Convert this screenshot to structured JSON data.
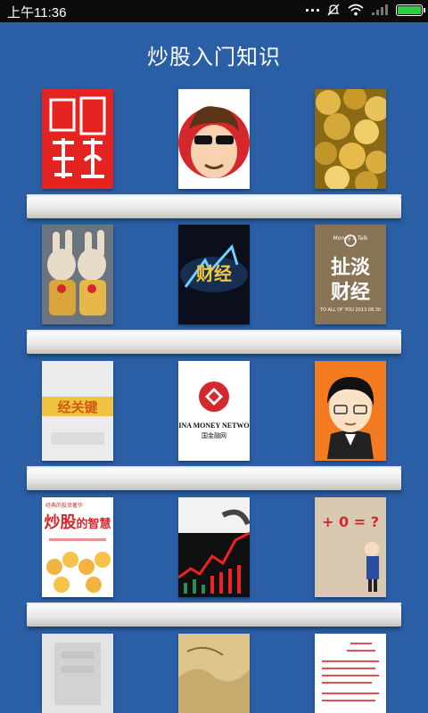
{
  "status_bar": {
    "time": "上午11:36"
  },
  "page_title": "炒股入门知识",
  "colors": {
    "background": "#2a5fa6",
    "status_bar": "#0c0c0c",
    "battery": "#2ecc40"
  },
  "books": [
    {
      "cover_text": ""
    },
    {
      "cover_text": ""
    },
    {
      "cover_text": ""
    },
    {
      "cover_text": ""
    },
    {
      "cover_text": ""
    },
    {
      "cover_line1": "扯淡",
      "cover_line2": "财经",
      "cover_top": "Money $ Talk",
      "cover_bottom": "TO ALL OF YOU 2013.08.30"
    },
    {
      "cover_text": ""
    },
    {
      "cover_line1": "INA MONEY NETWO",
      "cover_line2": "国金融网"
    },
    {
      "cover_text": ""
    },
    {
      "cover_line1": "炒股",
      "cover_line2": "的智慧",
      "cover_top": "经典的投资著作"
    },
    {
      "cover_text": ""
    },
    {
      "cover_line1": "+ 0 = ?"
    },
    {
      "cover_text": ""
    },
    {
      "cover_text": ""
    },
    {
      "cover_text": ""
    }
  ]
}
